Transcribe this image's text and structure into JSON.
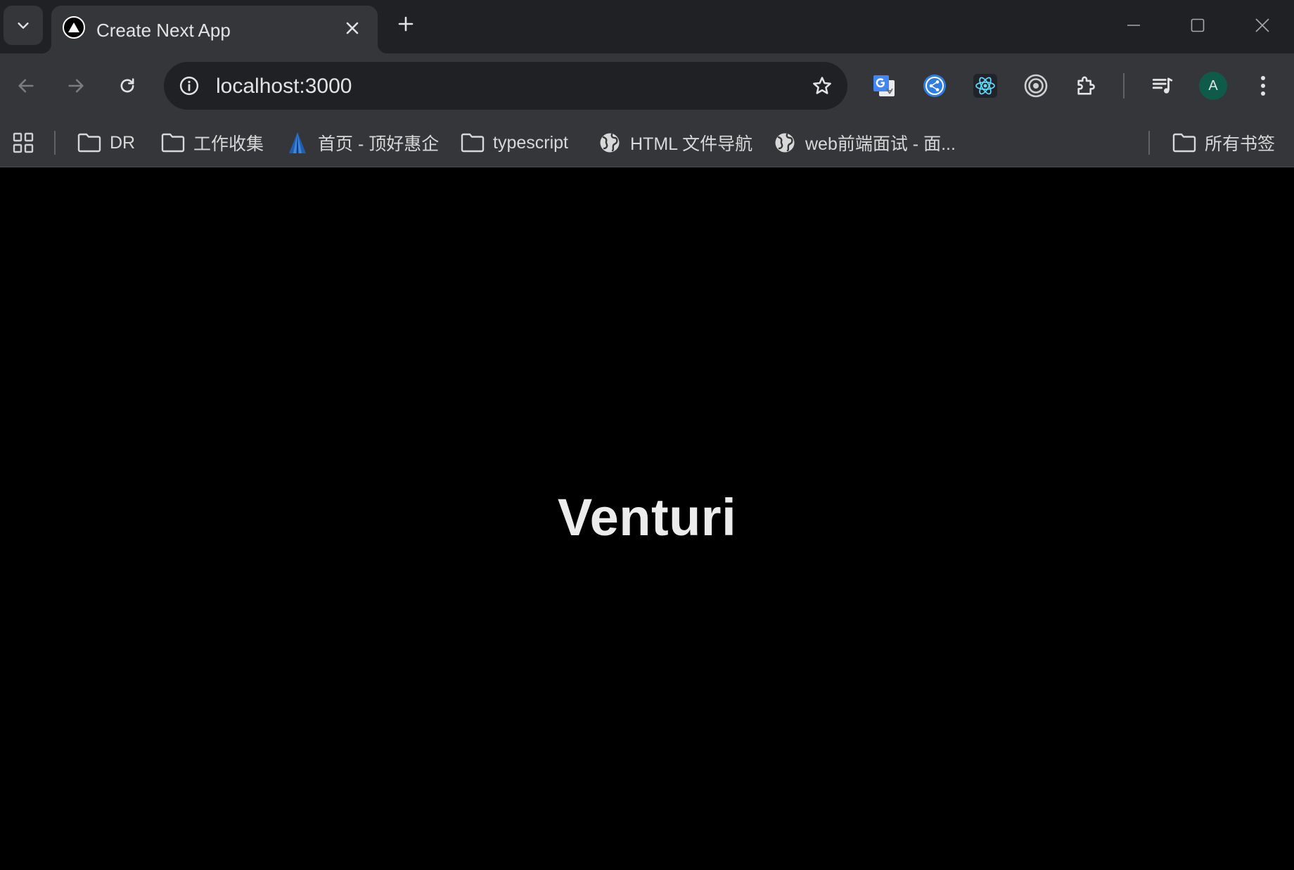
{
  "browser": {
    "tab": {
      "title": "Create Next App"
    },
    "toolbar": {
      "url": "localhost:3000",
      "avatar_letter": "A"
    },
    "icons": {
      "tab_search": "chevron-down-icon",
      "favicon": "triangle-icon",
      "tab_close": "close-icon",
      "new_tab": "plus-icon",
      "minimize": "minimize-icon",
      "maximize": "maximize-icon",
      "close_window": "close-icon",
      "back": "arrow-left-icon",
      "forward": "arrow-right-icon",
      "reload": "reload-icon",
      "site_info": "info-icon",
      "bookmark_star": "star-icon",
      "extensions": [
        "google-translate-icon",
        "share-icon",
        "react-icon",
        "target-icon",
        "puzzle-icon"
      ],
      "media": "media-control-icon",
      "menu": "kebab-menu-icon"
    },
    "bookmarks": {
      "items": [
        {
          "label": "DR",
          "icon": "folder-icon"
        },
        {
          "label": "工作收集",
          "icon": "folder-icon"
        },
        {
          "label": "首页 - 顶好惠企",
          "icon": "site-logo-icon"
        },
        {
          "label": "typescript",
          "icon": "folder-icon"
        },
        {
          "label": "HTML 文件导航",
          "icon": "globe-icon"
        },
        {
          "label": "web前端面试 - 面...",
          "icon": "globe-icon"
        }
      ],
      "all_bookmarks": "所有书签"
    },
    "colors": {
      "frame": "#202124",
      "toolbar": "#35363a",
      "omnibox": "#202124",
      "avatar": "#0f5b4a",
      "page_background": "#000000"
    }
  },
  "page": {
    "heading": "Venturi"
  }
}
